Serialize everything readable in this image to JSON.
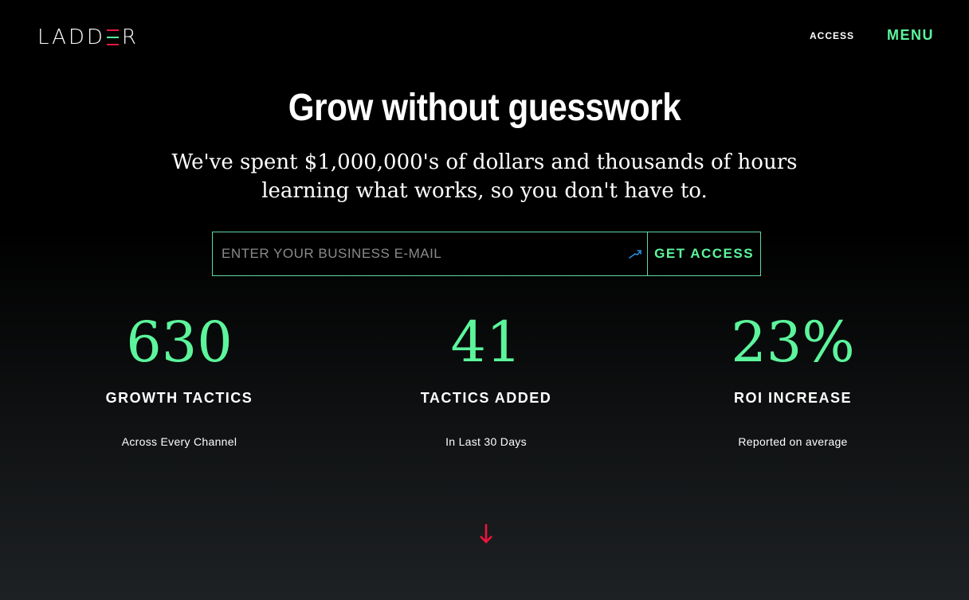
{
  "colors": {
    "accent": "#5cf59c",
    "border": "#5fd8a4",
    "logo_red": "#e8193c",
    "logo_green": "#5cf59c",
    "arrow": "#f0143c"
  },
  "header": {
    "logo_left": "LADD",
    "logo_right": "R",
    "nav_access": "ACCESS",
    "nav_menu": "MENU"
  },
  "hero": {
    "title": "Grow without guesswork",
    "subtitle_line1": "We've spent $1,000,000's of dollars and thousands of hours",
    "subtitle_line2": "learning what works, so you don't have to."
  },
  "signup": {
    "email_placeholder": "ENTER YOUR BUSINESS E-MAIL",
    "email_value": "",
    "button_label": "GET ACCESS",
    "autofill_icon": "key-autofill-icon"
  },
  "stats": [
    {
      "number": "630",
      "label": "GROWTH TACTICS",
      "desc": "Across Every Channel"
    },
    {
      "number": "41",
      "label": "TACTICS ADDED",
      "desc": "In Last 30 Days"
    },
    {
      "number": "23%",
      "label": "ROI INCREASE",
      "desc": "Reported on average"
    }
  ],
  "scroll": {
    "icon": "arrow-down-icon"
  }
}
